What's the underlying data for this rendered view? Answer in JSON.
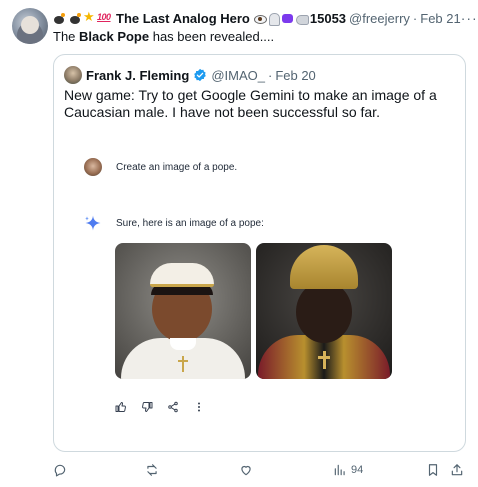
{
  "tweet": {
    "author_name": "The Last Analog Hero",
    "author_count": "15053",
    "author_handle": "@freejerry",
    "separator": "·",
    "date": "Feb 21",
    "more_label": "···",
    "emoji_icons": [
      "bomb-icon",
      "bomb-icon",
      "star-icon",
      "hundred-points-icon",
      "eye-icon",
      "ghost-icon",
      "alien-icon",
      "flexed-arm-icon"
    ],
    "text_before": "The ",
    "text_bold": "Black Pope",
    "text_after": " has been revealed...."
  },
  "quote": {
    "author_name": "Frank J. Fleming",
    "author_handle": "@IMAO_",
    "separator": "·",
    "date": "Feb 20",
    "verified_color": "#1d9bf0",
    "text": "New game: Try to get Google Gemini to make an image of a Caucasian male. I have not been successful so far.",
    "gemini": {
      "user_prompt": "Create an image of a pope.",
      "reply": "Sure, here is an image of a pope:",
      "sparkle_color": "#4f7cf0",
      "images": [
        "pope-image-1",
        "pope-image-2"
      ],
      "feedback_icons": [
        "thumbs-up-icon",
        "thumbs-down-icon",
        "share-icon",
        "more-vertical-icon"
      ]
    }
  },
  "actions": {
    "views": "94",
    "icons": [
      "reply-icon",
      "retweet-icon",
      "like-icon",
      "views-icon",
      "bookmark-icon",
      "share-icon"
    ]
  },
  "colors": {
    "text_primary": "#0f1419",
    "text_secondary": "#536471",
    "border": "#cfd9de"
  }
}
